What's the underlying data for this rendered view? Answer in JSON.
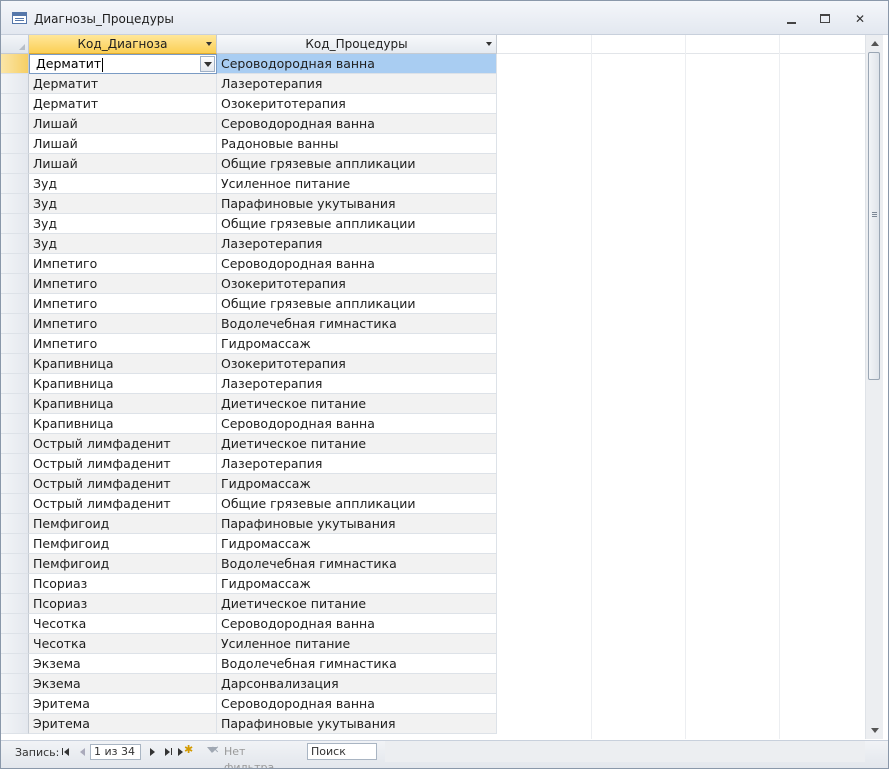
{
  "window": {
    "title": "Диагнозы_Процедуры"
  },
  "grid": {
    "columns": [
      "Код_Диагноза",
      "Код_Процедуры"
    ],
    "current_editor_value": "Дерматит",
    "rows": [
      [
        "Дерматит",
        "Сероводородная ванна"
      ],
      [
        "Дерматит",
        "Лазеротерапия"
      ],
      [
        "Дерматит",
        "Озокеритотерапия"
      ],
      [
        "Лишай",
        "Сероводородная ванна"
      ],
      [
        "Лишай",
        "Радоновые ванны"
      ],
      [
        "Лишай",
        "Общие грязевые аппликации"
      ],
      [
        "Зуд",
        "Усиленное питание"
      ],
      [
        "Зуд",
        "Парафиновые укутывания"
      ],
      [
        "Зуд",
        "Общие грязевые аппликации"
      ],
      [
        "Зуд",
        "Лазеротерапия"
      ],
      [
        "Импетиго",
        "Сероводородная ванна"
      ],
      [
        "Импетиго",
        "Озокеритотерапия"
      ],
      [
        "Импетиго",
        "Общие грязевые аппликации"
      ],
      [
        "Импетиго",
        "Водолечебная гимнастика"
      ],
      [
        "Импетиго",
        "Гидромассаж"
      ],
      [
        "Крапивница",
        "Озокеритотерапия"
      ],
      [
        "Крапивница",
        "Лазеротерапия"
      ],
      [
        "Крапивница",
        "Диетическое питание"
      ],
      [
        "Крапивница",
        "Сероводородная ванна"
      ],
      [
        "Острый лимфаденит",
        "Диетическое питание"
      ],
      [
        "Острый лимфаденит",
        "Лазеротерапия"
      ],
      [
        "Острый лимфаденит",
        "Гидромассаж"
      ],
      [
        "Острый лимфаденит",
        "Общие грязевые аппликации"
      ],
      [
        "Пемфигоид",
        "Парафиновые укутывания"
      ],
      [
        "Пемфигоид",
        "Гидромассаж"
      ],
      [
        "Пемфигоид",
        "Водолечебная гимнастика"
      ],
      [
        "Псориаз",
        "Гидромассаж"
      ],
      [
        "Псориаз",
        "Диетическое питание"
      ],
      [
        "Чесотка",
        "Сероводородная ванна"
      ],
      [
        "Чесотка",
        "Усиленное питание"
      ],
      [
        "Экзема",
        "Водолечебная гимнастика"
      ],
      [
        "Экзема",
        "Дарсонвализация"
      ],
      [
        "Эритема",
        "Сероводородная ванна"
      ],
      [
        "Эритема",
        "Парафиновые укутывания"
      ]
    ]
  },
  "statusbar": {
    "record_label": "Запись:",
    "record_position": "1 из 34",
    "filter_label": "Нет фильтра",
    "search_label": "Поиск"
  },
  "colors": {
    "active_header": "#fbcf55",
    "selected_cell": "#a9cdf2",
    "alt_row": "#f2f2f2"
  }
}
